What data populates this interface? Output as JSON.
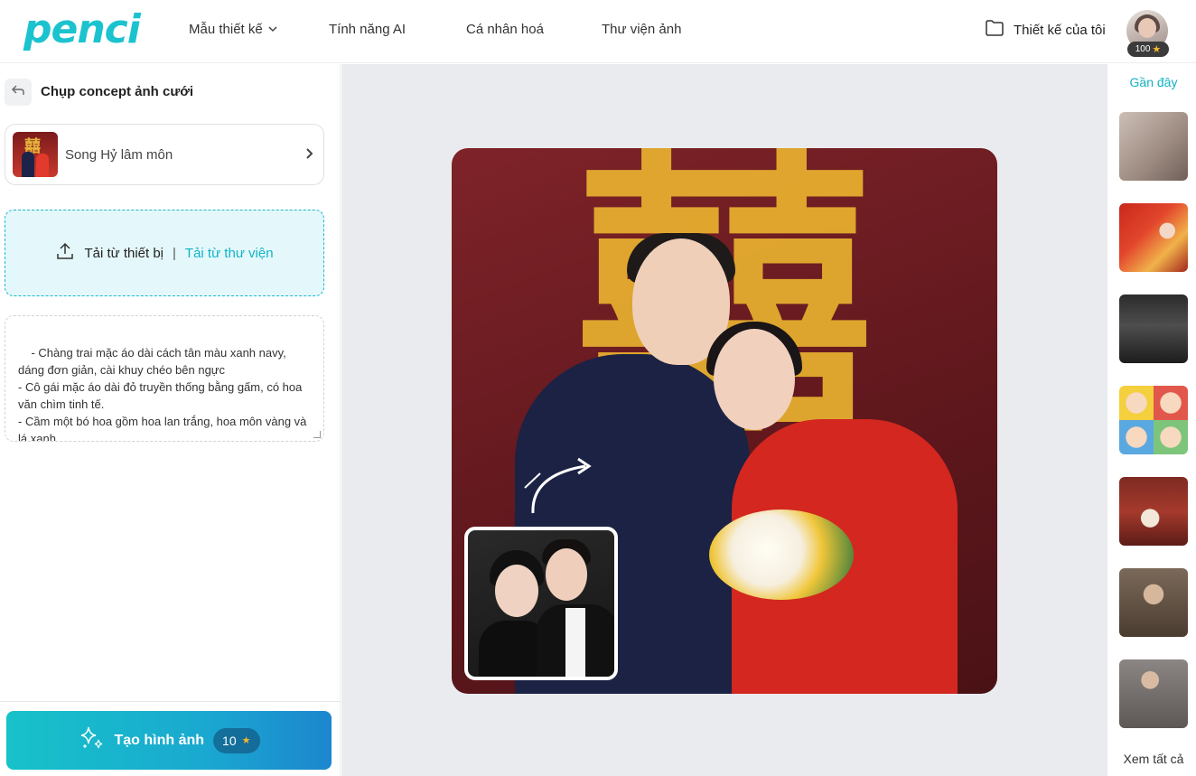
{
  "header": {
    "logo_text": "penci",
    "nav": [
      {
        "label": "Mẫu thiết kế",
        "has_dropdown": true
      },
      {
        "label": "Tính năng AI"
      },
      {
        "label": "Cá nhân hoá"
      },
      {
        "label": "Thư viện ảnh"
      }
    ],
    "my_designs_label": "Thiết kế của tôi",
    "credits": "100"
  },
  "left_panel": {
    "title": "Chụp concept ảnh cưới",
    "template_name": "Song Hỷ lâm môn",
    "upload_device_label": "Tải từ thiết bị",
    "upload_separator": "|",
    "upload_library_label": "Tải từ thư viện",
    "prompt_text": "- Chàng trai mặc áo dài cách tân màu xanh navy, dáng đơn giản, cài khuy chéo bên ngực\n- Cô gái mặc áo dài đỏ truyền thống bằng gấm, có hoa văn chìm tinh tế.\n- Cầm một bó hoa gồm hoa lan trắng, hoa môn vàng và lá xanh",
    "generate_label": "Tạo hình ảnh",
    "generate_cost": "10"
  },
  "canvas": {
    "hy_character": "囍"
  },
  "right_panel": {
    "recent_label": "Gần đây",
    "see_all_label": "Xem tất cả"
  },
  "colors": {
    "brand": "#1bc3cf",
    "accent_text": "#13b3c4",
    "upload_bg": "#e4f8fb",
    "canvas_bg": "#e9ebef",
    "star": "#f5b82e"
  },
  "icons": [
    "chevron-down-icon",
    "folder-icon",
    "star-icon",
    "back-icon",
    "chevron-right-icon",
    "upload-icon",
    "sparkles-icon",
    "curved-arrow-icon"
  ]
}
